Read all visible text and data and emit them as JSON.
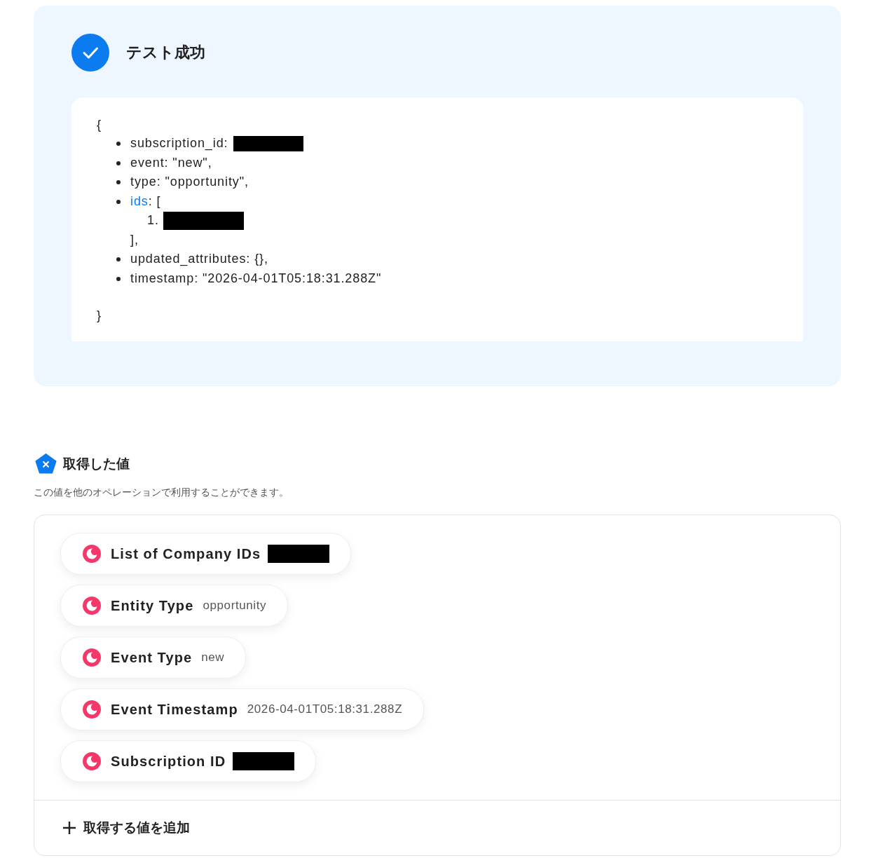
{
  "test_result": {
    "title": "テスト成功",
    "open_brace": "{",
    "close_brace": "}",
    "entries": [
      {
        "key": "subscription_id",
        "rest": ":",
        "link": false,
        "redacted": true
      },
      {
        "key": "event",
        "rest": ": \"new\",",
        "link": false,
        "redacted": false
      },
      {
        "key": "type",
        "rest": ": \"opportunity\",",
        "link": false,
        "redacted": false
      },
      {
        "key": "ids",
        "rest": ": [",
        "link": true,
        "redacted": false,
        "items": [
          {
            "number": "1.",
            "redacted": true
          }
        ],
        "closing": "],"
      },
      {
        "key": "updated_attributes",
        "rest": ": {},",
        "link": false,
        "redacted": false
      },
      {
        "key": "timestamp",
        "rest": ": \"2026-04-01T05:18:31.288Z\"",
        "link": false,
        "redacted": false
      }
    ]
  },
  "values_section": {
    "title": "取得した値",
    "description": "この値を他のオペレーションで利用することができます。",
    "values": [
      {
        "label": "List of Company IDs",
        "redacted": true
      },
      {
        "label": "Entity Type",
        "value": "opportunity",
        "redacted": false
      },
      {
        "label": "Event Type",
        "value": "new",
        "redacted": false
      },
      {
        "label": "Event Timestamp",
        "value": "2026-04-01T05:18:31.288Z",
        "redacted": false
      },
      {
        "label": "Subscription ID",
        "redacted": true
      }
    ],
    "add_button": "取得する値を追加"
  }
}
